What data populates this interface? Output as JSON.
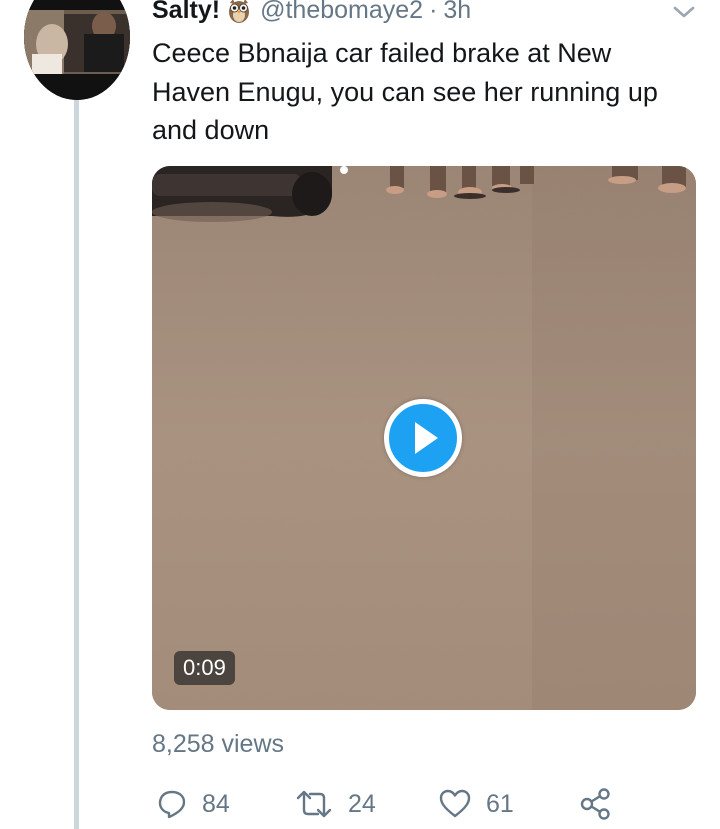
{
  "tweet": {
    "display_name": "Salty!",
    "badge_icon": "owl-emoji-icon",
    "handle": "@thebomaye2",
    "separator": "·",
    "time": "3h",
    "text": "Ceece Bbnaija car failed brake at New Haven Enugu, you can see her running up and down",
    "more_icon": "chevron-down-icon"
  },
  "media": {
    "type": "video",
    "play_icon": "play-icon",
    "duration": "0:09",
    "views": "8,258 views"
  },
  "actions": {
    "reply": {
      "icon": "reply-icon",
      "count": "84"
    },
    "retweet": {
      "icon": "retweet-icon",
      "count": "24"
    },
    "like": {
      "icon": "heart-icon",
      "count": "61"
    },
    "share": {
      "icon": "share-icon"
    }
  },
  "colors": {
    "accent": "#1da1f2",
    "text": "#14171a",
    "secondary_text": "#657786",
    "thread_line": "#ccd6dd"
  }
}
